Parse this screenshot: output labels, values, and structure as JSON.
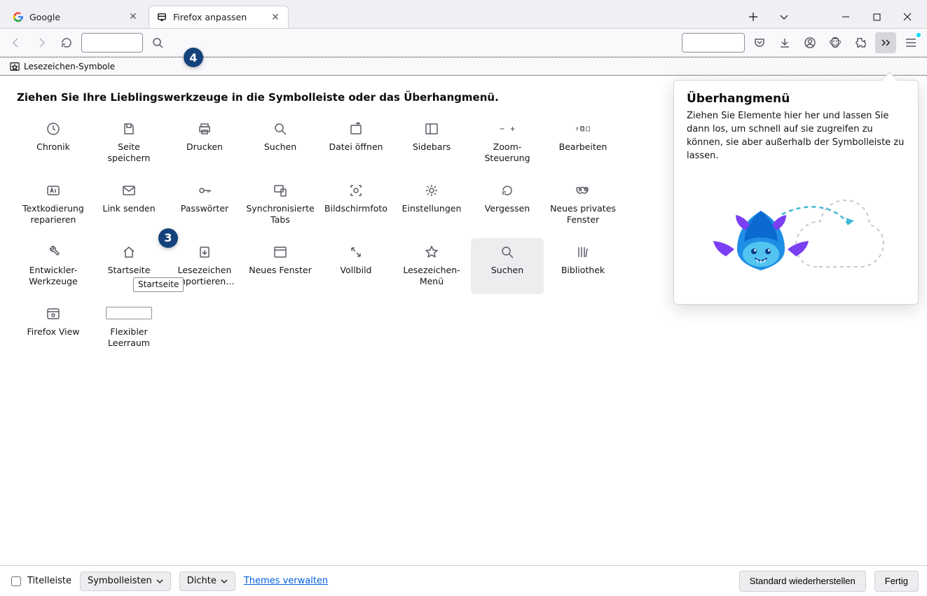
{
  "tabs": [
    {
      "label": "Google"
    },
    {
      "label": "Firefox anpassen"
    }
  ],
  "bookmarks_toolbar": {
    "item_label": "Lesezeichen-Symbole"
  },
  "palette": {
    "heading": "Ziehen Sie Ihre Lieblingswerkzeuge in die Symbolleiste oder das Überhangmenü.",
    "items": [
      "Chronik",
      "Seite speichern",
      "Drucken",
      "Suchen",
      "Datei öffnen",
      "Sidebars",
      "Zoom-Steuerung",
      "Bearbeiten",
      "Textkodierung reparieren",
      "Link senden",
      "Passwörter",
      "Synchronisierte Tabs",
      "Bildschirmfoto",
      "Einstellungen",
      "Vergessen",
      "Neues privates Fenster",
      "Entwickler-Werkzeuge",
      "Startseite",
      "Lesezeichen importieren…",
      "Neues Fenster",
      "Vollbild",
      "Lesezeichen-Menü",
      "Suchen",
      "Bibliothek",
      "Firefox View",
      "Flexibler Leerraum"
    ]
  },
  "tooltip": {
    "startseite": "Startseite"
  },
  "overflow": {
    "title": "Überhangmenü",
    "text": "Ziehen Sie Elemente hier her und lassen Sie dann los, um schnell auf sie zugreifen zu können, sie aber außerhalb der Symbolleiste zu lassen."
  },
  "footer": {
    "titlebar_checkbox": "Titelleiste",
    "toolbars_dropdown": "Symbolleisten",
    "density_dropdown": "Dichte",
    "themes_link": "Themes verwalten",
    "restore": "Standard wiederherstellen",
    "done": "Fertig"
  },
  "badges": {
    "b3": "3",
    "b4": "4"
  }
}
